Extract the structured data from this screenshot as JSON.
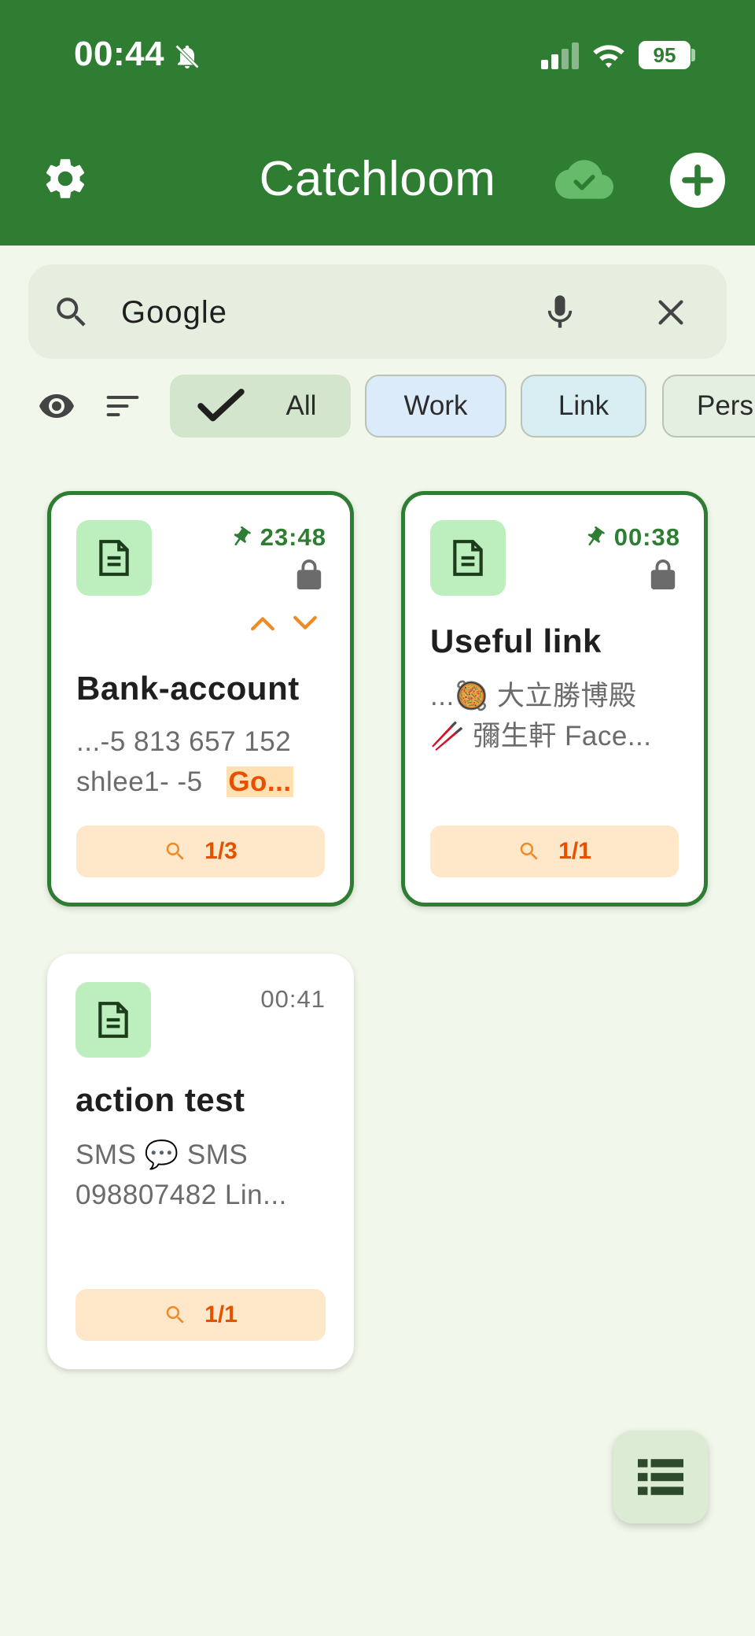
{
  "status_bar": {
    "time": "00:44",
    "battery": "95"
  },
  "header": {
    "title": "Catchloom"
  },
  "search": {
    "value": "Google",
    "placeholder": ""
  },
  "filters": {
    "chips": [
      {
        "label": "All",
        "selected": true
      },
      {
        "label": "Work"
      },
      {
        "label": "Link"
      },
      {
        "label": "Pers"
      }
    ]
  },
  "cards": [
    {
      "time": "23:48",
      "pinned": true,
      "locked": true,
      "title": "Bank-account",
      "body_line1": "...-5  813 657 152",
      "body_line2_prefix": "shlee1- -5  ",
      "body_highlight": "Go...",
      "match": "1/3"
    },
    {
      "time": "00:38",
      "pinned": true,
      "locked": true,
      "title": "Useful link",
      "body_line1": "...🥘 大立勝博殿",
      "body_line2": "🥢 彌生軒   Face...",
      "match": "1/1"
    },
    {
      "time": "00:41",
      "pinned": false,
      "locked": false,
      "title": "action test",
      "body_line1": "SMS 💬  SMS",
      "body_line2": "098807482  Lin...",
      "match": "1/1"
    }
  ],
  "colors": {
    "primary": "#2e7d32",
    "background": "#f1f7ea",
    "accent_orange": "#e65100",
    "match_bg": "#ffe7c9"
  },
  "icons": [
    "bell-off-icon",
    "signal-icon",
    "wifi-icon",
    "gear-icon",
    "cloud-check-icon",
    "add-icon",
    "search-icon",
    "mic-icon",
    "close-icon",
    "eye-icon",
    "sort-icon",
    "check-icon",
    "doc-icon",
    "pin-icon",
    "lock-icon",
    "chevron-up-icon",
    "chevron-down-icon",
    "list-view-icon"
  ]
}
